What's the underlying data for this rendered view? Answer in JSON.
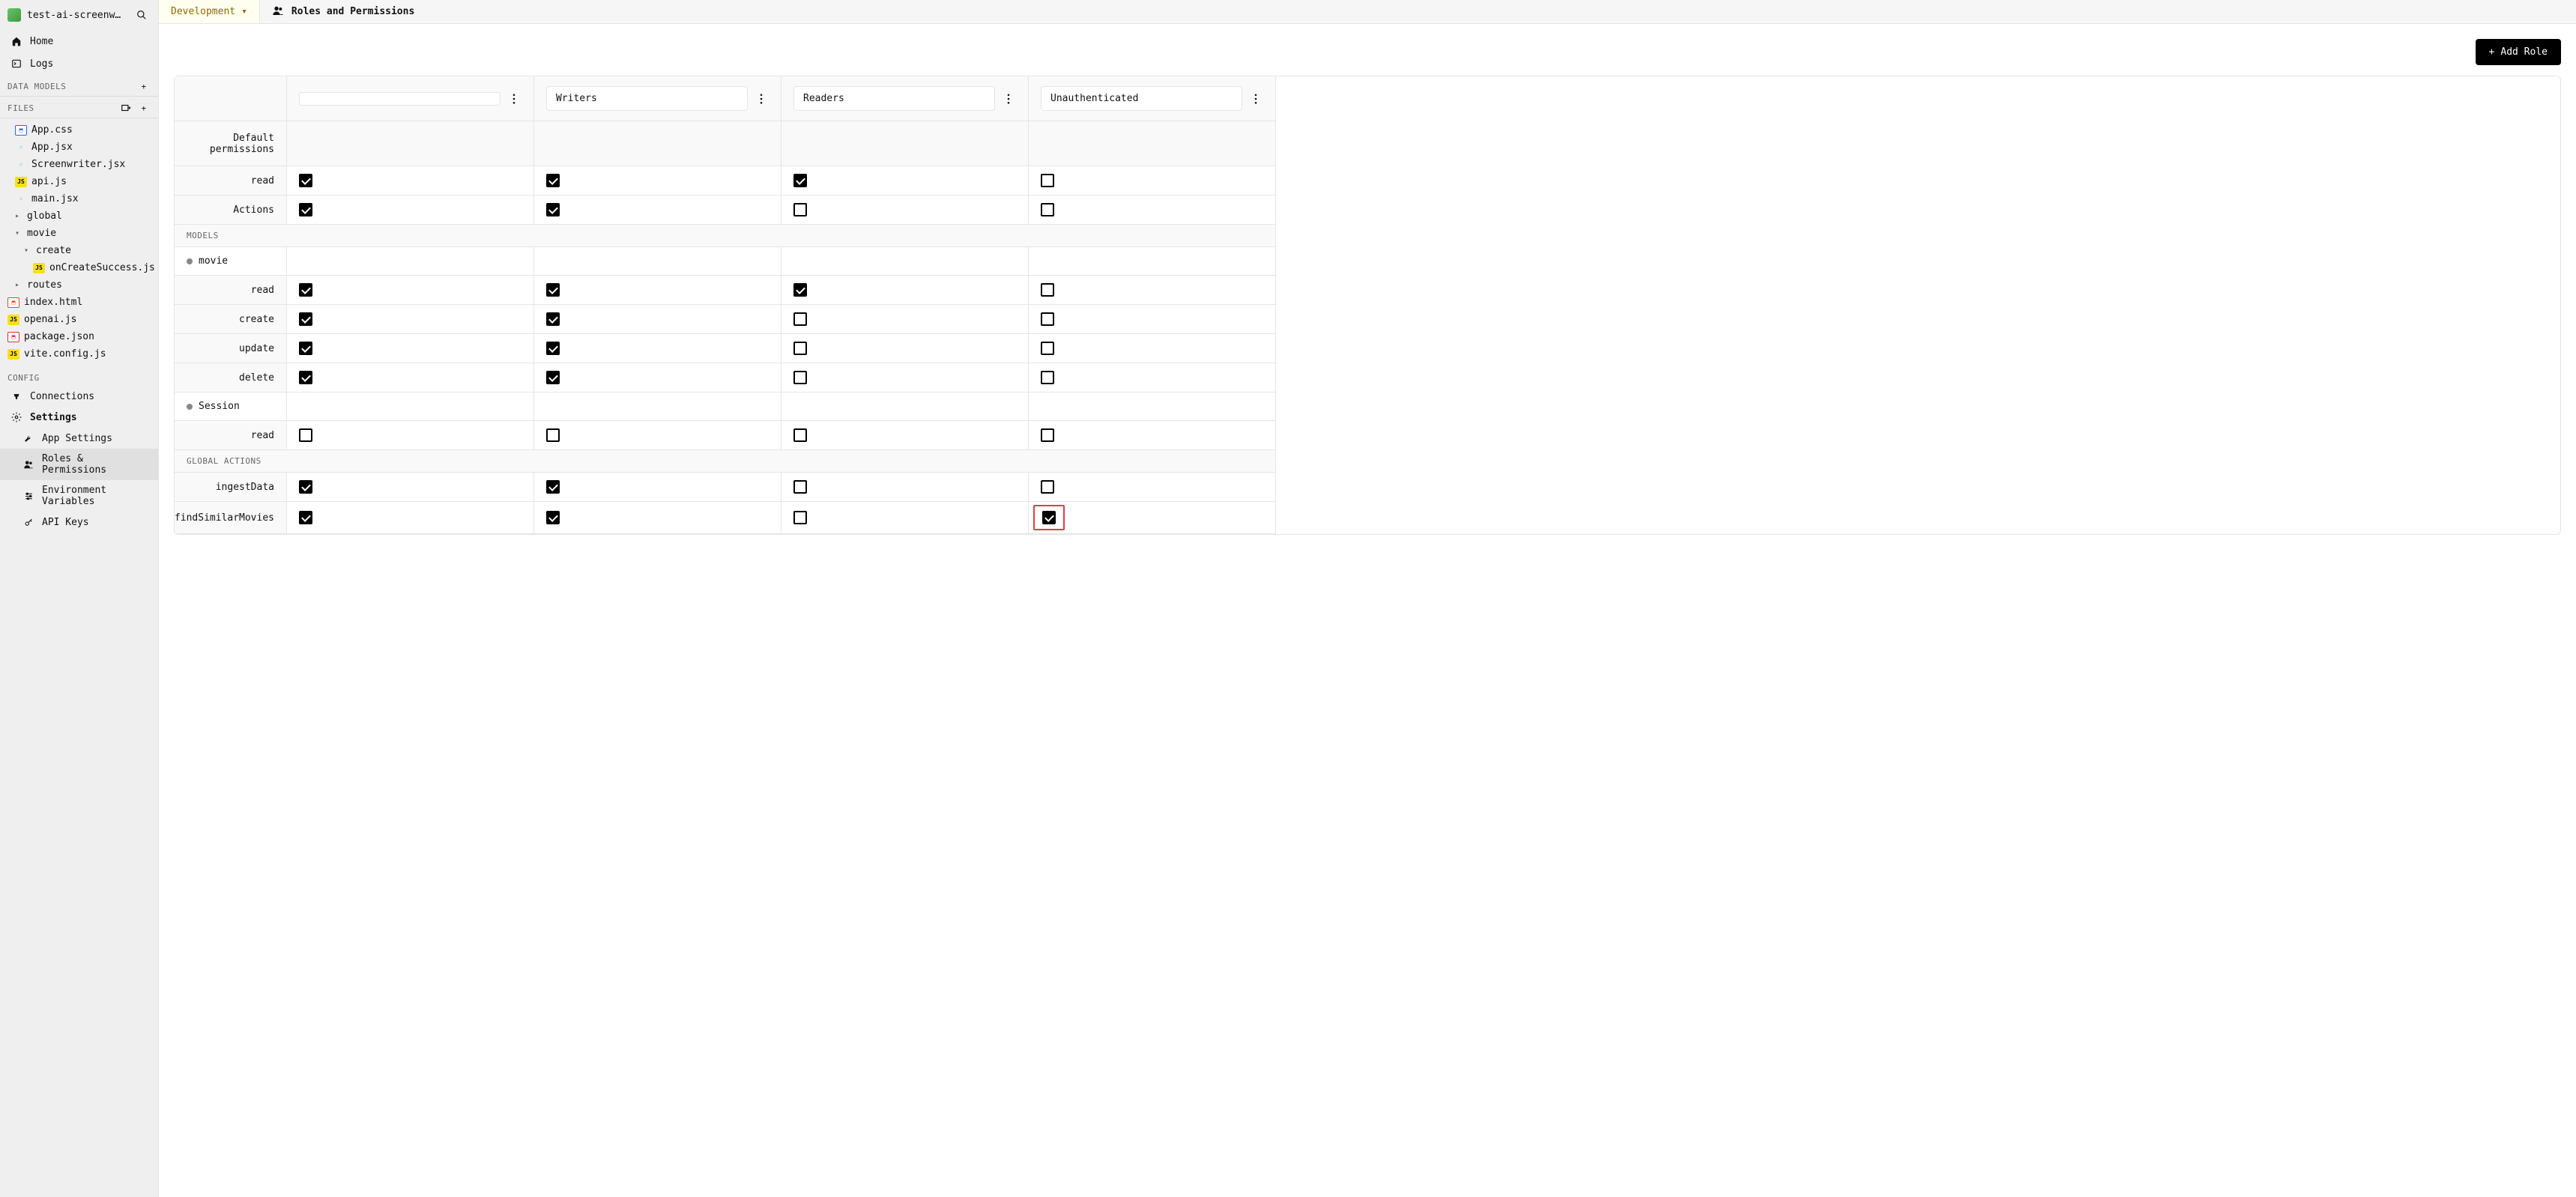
{
  "app": {
    "name": "test-ai-screenwrit…"
  },
  "nav": {
    "home": "Home",
    "logs": "Logs"
  },
  "sections": {
    "dataModels": "DATA MODELS",
    "files": "FILES",
    "config": "CONFIG"
  },
  "files": {
    "appCss": "App.css",
    "appJsx": "App.jsx",
    "screenwriter": "Screenwriter.jsx",
    "apiJs": "api.js",
    "mainJsx": "main.jsx",
    "global": "global",
    "movie": "movie",
    "create": "create",
    "onCreateSuccess": "onCreateSuccess.js",
    "routes": "routes",
    "indexHtml": "index.html",
    "openaiJs": "openai.js",
    "packageJson": "package.json",
    "viteConfig": "vite.config.js"
  },
  "config": {
    "connections": "Connections",
    "settings": "Settings",
    "appSettings": "App Settings",
    "roles": "Roles & Permissions",
    "envVars": "Environment Variables",
    "apiKeys": "API Keys"
  },
  "topbar": {
    "env": "Development",
    "pageTitle": "Roles and Permissions"
  },
  "toolbar": {
    "addRole": "Add Role"
  },
  "roles": [
    "",
    "Writers",
    "Readers",
    "Unauthenticated"
  ],
  "labels": {
    "defaultPerms": "Default permissions",
    "read": "read",
    "actions": "Actions",
    "models": "MODELS",
    "movie": "movie",
    "create": "create",
    "update": "update",
    "delete": "delete",
    "session": "Session",
    "globalActions": "GLOBAL ACTIONS",
    "ingestData": "ingestData",
    "findSimilarMovies": "findSimilarMovies"
  },
  "perms": {
    "default_read": {
      "c0": true,
      "c1": true,
      "c2": true,
      "c3": false
    },
    "default_actions": {
      "c0": true,
      "c1": true,
      "c2": false,
      "c3": false
    },
    "movie_read": {
      "c0": true,
      "c1": true,
      "c2": true,
      "c3": false
    },
    "movie_create": {
      "c0": true,
      "c1": true,
      "c2": false,
      "c3": false
    },
    "movie_update": {
      "c0": true,
      "c1": true,
      "c2": false,
      "c3": false
    },
    "movie_delete": {
      "c0": true,
      "c1": true,
      "c2": false,
      "c3": false
    },
    "session_read": {
      "c0": false,
      "c1": false,
      "c2": false,
      "c3": false
    },
    "ingestData": {
      "c0": true,
      "c1": true,
      "c2": false,
      "c3": false
    },
    "findSimilar": {
      "c0": true,
      "c1": true,
      "c2": false,
      "c3": true
    }
  }
}
